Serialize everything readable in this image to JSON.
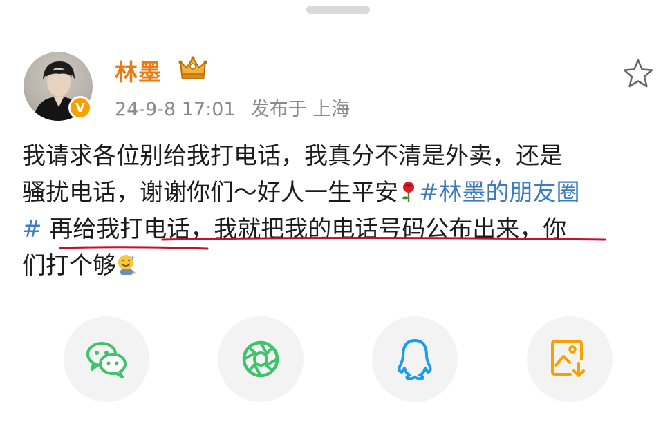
{
  "header": {
    "username": "林墨",
    "timestamp": "24-9-8 17:01",
    "location": "发布于 上海",
    "verified_mark": "V",
    "avatar_icon": "avatar-icon",
    "vip_icon": "crown-icon",
    "star_icon": "star-icon"
  },
  "post": {
    "line1": "我请求各位别给我打电话，我真分不清是外卖，还是",
    "line2_text": "骚扰电话，谢谢你们～好人一生平安",
    "line2_hashtag": "#林墨的朋友圈",
    "line3_hashtag": "#",
    "line3_text": " 再给我打电话，我就把我的电话号码公布出来，你",
    "line4": "们打个够",
    "emojis": [
      "rose-icon",
      "sweat-smile-icon"
    ],
    "highlight_color": "#c8102e"
  },
  "share": {
    "buttons": [
      {
        "name": "wechat-share-button",
        "icon": "wechat-icon",
        "color": "#3fc26b"
      },
      {
        "name": "moments-share-button",
        "icon": "moments-icon",
        "color": "#3fc26b"
      },
      {
        "name": "qq-share-button",
        "icon": "qq-icon",
        "color": "#1e9bf0"
      },
      {
        "name": "save-image-button",
        "icon": "save-image-icon",
        "color": "#f7a100"
      }
    ]
  },
  "colors": {
    "username": "#ec7a12",
    "hashtag": "#3e7bbf",
    "meta": "#8a8a8a",
    "badge": "#f7a100"
  }
}
